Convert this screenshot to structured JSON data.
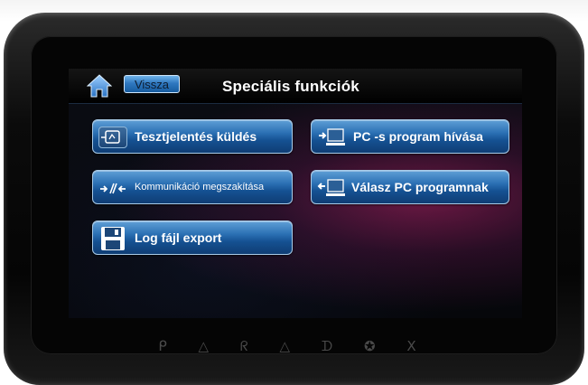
{
  "header": {
    "back_label": "Vissza",
    "title": "Speciális funkciók"
  },
  "buttons": {
    "test_report": "Tesztjelentés küldés",
    "pc_call": "PC -s program hívása",
    "comm_abort": "Kommunikáció megszakítása",
    "pc_answer": "Válasz PC programnak",
    "log_export": "Log fájl export"
  },
  "device": {
    "brand_logo": "PARADOX"
  },
  "icons": {
    "home": "home-icon",
    "test_report": "signal-report-icon",
    "pc_call": "pc-call-icon",
    "comm_abort": "comm-abort-icon",
    "pc_answer": "pc-answer-icon",
    "log_export": "floppy-disk-icon"
  },
  "colors": {
    "button_blue": "#2a6fb3",
    "screen_magenta": "#961e5a",
    "bezel": "#050505"
  }
}
